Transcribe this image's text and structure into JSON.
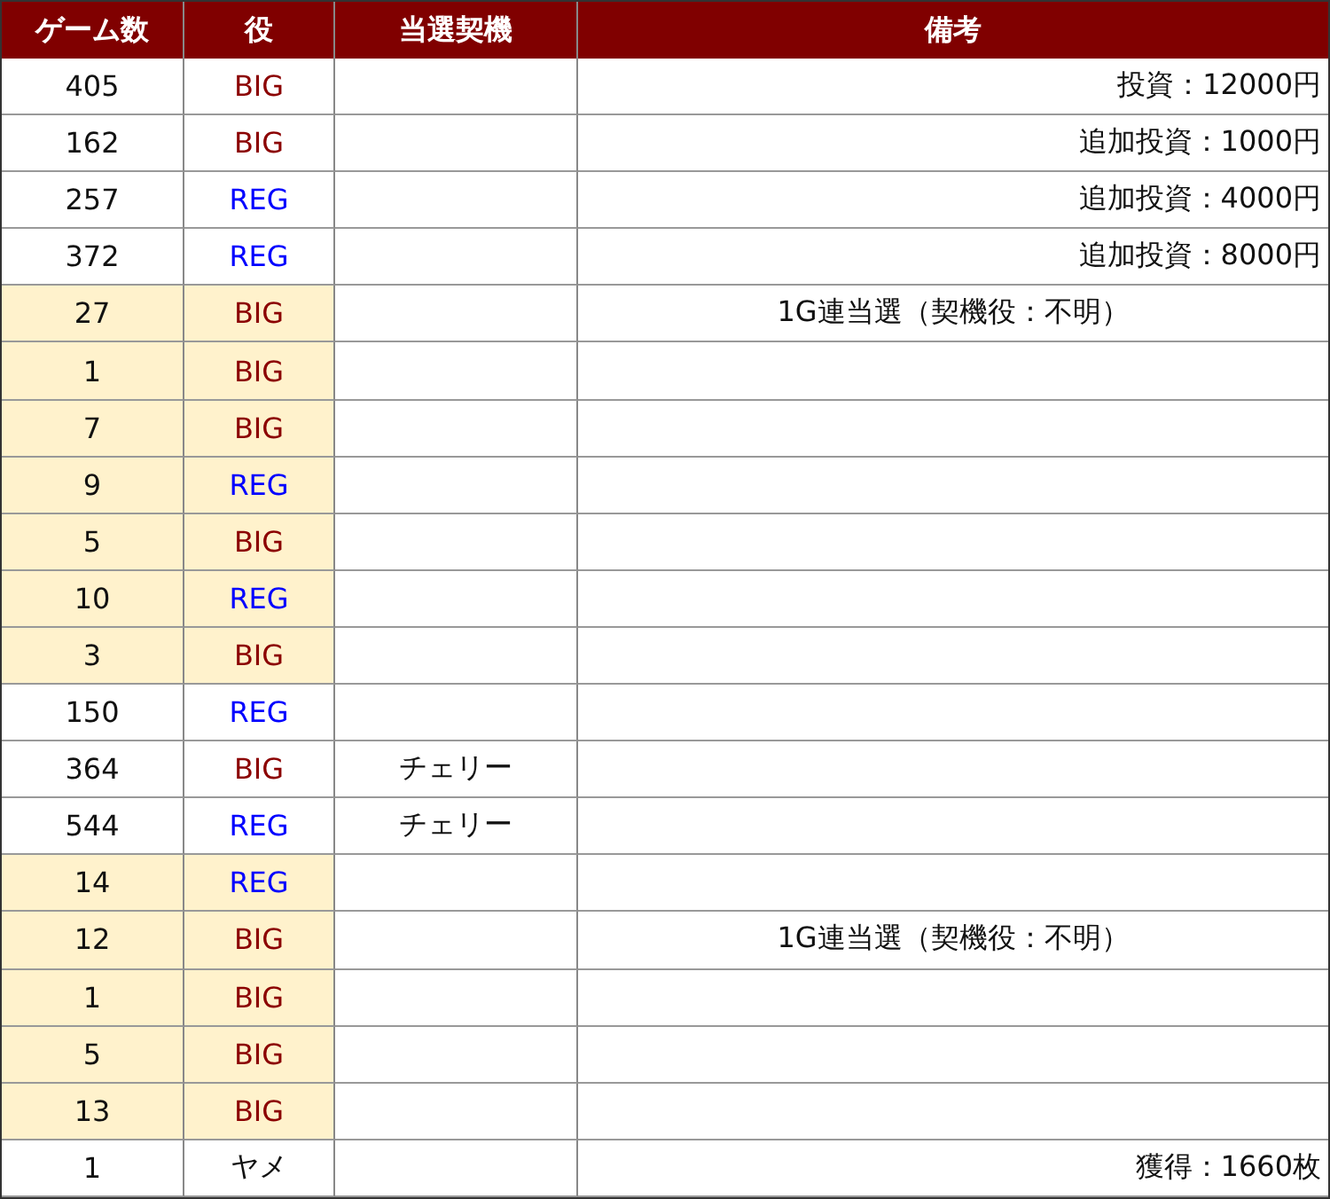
{
  "table": {
    "columns": [
      "ゲーム数",
      "役",
      "当選契機",
      "備考"
    ],
    "rows": [
      {
        "games": "405",
        "role": "BIG",
        "kind": "big",
        "highlighted": false,
        "note": "投資：12000円",
        "note_centered": false
      },
      {
        "games": "162",
        "role": "BIG",
        "kind": "big",
        "highlighted": false,
        "note": "追加投資：1000円",
        "note_centered": false
      },
      {
        "games": "257",
        "role": "REG",
        "kind": "reg",
        "highlighted": false,
        "note": "追加投資：4000円",
        "note_centered": false
      },
      {
        "games": "372",
        "role": "REG",
        "kind": "reg",
        "highlighted": false,
        "note": "追加投資：8000円",
        "note_centered": false
      },
      {
        "games": "27",
        "role": "BIG",
        "kind": "big",
        "highlighted": true,
        "note": "1G連当選（契機役：不明）",
        "note_centered": true
      },
      {
        "games": "1",
        "role": "BIG",
        "kind": "big",
        "highlighted": true
      },
      {
        "games": "7",
        "role": "BIG",
        "kind": "big",
        "highlighted": true
      },
      {
        "games": "9",
        "role": "REG",
        "kind": "reg",
        "highlighted": true
      },
      {
        "games": "5",
        "role": "BIG",
        "kind": "big",
        "highlighted": true
      },
      {
        "games": "10",
        "role": "REG",
        "kind": "reg",
        "highlighted": true
      },
      {
        "games": "3",
        "role": "BIG",
        "kind": "big",
        "highlighted": true
      },
      {
        "games": "150",
        "role": "REG",
        "kind": "reg",
        "highlighted": false
      },
      {
        "games": "364",
        "role": "BIG",
        "kind": "big",
        "highlighted": false,
        "trigger": "チェリー"
      },
      {
        "games": "544",
        "role": "REG",
        "kind": "reg",
        "highlighted": false,
        "trigger": "チェリー"
      },
      {
        "games": "14",
        "role": "REG",
        "kind": "reg",
        "highlighted": true
      },
      {
        "games": "12",
        "role": "BIG",
        "kind": "big",
        "highlighted": true,
        "note": "1G連当選（契機役：不明）",
        "note_centered": true
      },
      {
        "games": "1",
        "role": "BIG",
        "kind": "big",
        "highlighted": true
      },
      {
        "games": "5",
        "role": "BIG",
        "kind": "big",
        "highlighted": true
      },
      {
        "games": "13",
        "role": "BIG",
        "kind": "big",
        "highlighted": true
      },
      {
        "games": "1",
        "role": "ヤメ",
        "kind": "stop",
        "highlighted": false,
        "note": "獲得：1660枚",
        "note_centered": false
      }
    ]
  }
}
